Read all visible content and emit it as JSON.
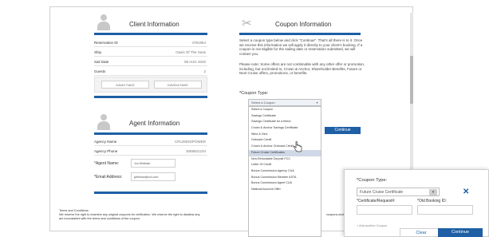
{
  "client_info": {
    "title": "Client Information",
    "rows": [
      {
        "label": "Reservation ID",
        "value": "4781954"
      },
      {
        "label": "Ship",
        "value": "Oasis Of The Seas"
      },
      {
        "label": "Sail Date",
        "value": "08 AUG 2020"
      },
      {
        "label": "Guests",
        "value": "2"
      }
    ],
    "guests": [
      "DAVID FAKE",
      "DAVIDA FAKE"
    ]
  },
  "agent_info": {
    "title": "Agent Information",
    "rows": [
      {
        "label": "Agency Name",
        "value": "CRUISINGPOWER"
      },
      {
        "label": "Agency Phone",
        "value": "3059821234"
      }
    ],
    "agent_name_label": "*Agent Name:",
    "agent_name_value": "Jon Whitman",
    "email_label": "*Email Address:",
    "email_value": "jwhitman@rccl.com"
  },
  "coupon_info": {
    "title": "Coupon Information",
    "intro": "Select a coupon type below and click \"Continue\". That's all there is to it. Once we receive this information we will apply it directly to your client's booking. If a coupon is not eligible for the sailing date or reservation submitted, we will contact you.",
    "note": "Please note: Some offers are not combinable with any other offer or promotion, including, but not limited to, Crown & Anchor, Shareholder Benefits, Future or Next Cruise offers, promotions, or benefits.",
    "type_label": "*Coupon Type:",
    "select_placeholder": "Select a Coupon",
    "options": [
      "Select a Coupon",
      "Savings Certificate",
      "Savings Certificate for a friend",
      "Crown & Anchor Savings Certificate",
      "Wine & Dine",
      "Onboard Credit",
      "Crown & Anchor Onboard Credit",
      "Future Cruise Certificates",
      "Non-Refundable Deposit FCC",
      "Letter Of Credit",
      "Bonus Commission Agency CUA",
      "Bonus Commission Member ASTA",
      "Bonus Commission Agent CUA",
      "National Account Offer"
    ],
    "selected_index": 7,
    "continue_label": "Continue"
  },
  "terms": {
    "heading": "Terms and Conditions",
    "text": "We reserve the right to examine any original coupons for verification. We reserve the right to disallow any",
    "text2": "are inconsistent with the terms and conditions of the coupon.",
    "right_text": "coupons and those w"
  },
  "popup": {
    "type_label": "*Coupon Type:",
    "selected_value": "Future Cruise Certificate",
    "cert_label": "*Certificate/Request#:",
    "booking_label": "*Old Booking ID:",
    "add_link": "+ Add another Coupon",
    "clear_label": "Clear",
    "continue_label": "Continue"
  },
  "icons": {
    "person": "person-icon",
    "scissors": "scissors-icon",
    "close": "close-icon",
    "chevron": "chevron-down-icon",
    "cursor": "hand-cursor-icon"
  },
  "colors": {
    "accent": "#1e5fa5",
    "highlight": "#cfd8e6"
  }
}
